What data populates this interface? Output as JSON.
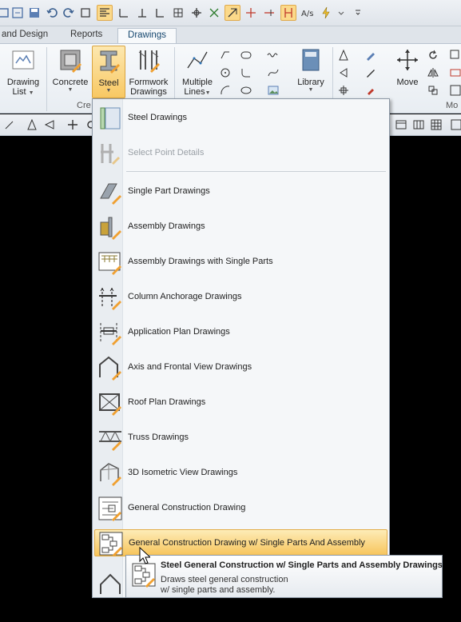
{
  "tabs": [
    {
      "label": "and Design"
    },
    {
      "label": "Reports"
    },
    {
      "label": "Drawings"
    }
  ],
  "ribbon": {
    "drawing_list": {
      "line1": "Drawing",
      "line2": "List"
    },
    "concrete": "Concrete",
    "steel": "Steel",
    "formwork": {
      "line1": "Formwork",
      "line2": "Drawings"
    },
    "multiple_lines": {
      "line1": "Multiple",
      "line2": "Lines"
    },
    "library": "Library",
    "move": "Move",
    "group_create": "Cre",
    "group_modify": "Mo"
  },
  "menu": {
    "items": [
      {
        "label": "Steel Drawings",
        "icon": "steel-drawings-icon"
      },
      {
        "label": "Select Point Details",
        "icon": "select-point-details-icon",
        "disabled": true
      },
      {
        "label": "Single Part Drawings",
        "icon": "single-part-icon"
      },
      {
        "label": "Assembly Drawings",
        "icon": "assembly-icon"
      },
      {
        "label": "Assembly Drawings with Single Parts",
        "icon": "assembly-single-parts-icon"
      },
      {
        "label": "Column Anchorage Drawings",
        "icon": "column-anchorage-icon"
      },
      {
        "label": "Application Plan Drawings",
        "icon": "application-plan-icon"
      },
      {
        "label": "Axis and Frontal View Drawings",
        "icon": "axis-frontal-icon"
      },
      {
        "label": "Roof Plan Drawings",
        "icon": "roof-plan-icon"
      },
      {
        "label": "Truss Drawings",
        "icon": "truss-icon"
      },
      {
        "label": "3D Isometric View Drawings",
        "icon": "isometric-icon"
      },
      {
        "label": "General Construction Drawing",
        "icon": "general-construction-icon"
      },
      {
        "label": "General Construction Drawing w/ Single Parts And Assembly",
        "icon": "general-construction-assembly-icon",
        "highlighted": true
      }
    ]
  },
  "tooltip": {
    "title": "Steel General Construction w/ Single Parts and Assembly Drawings",
    "description_line1": "Draws steel general construction",
    "description_line2": "w/ single parts and assembly."
  },
  "colors": {
    "highlight": "#f7c45a",
    "accent_orange": "#f0a030",
    "tab_text": "#14466e"
  }
}
